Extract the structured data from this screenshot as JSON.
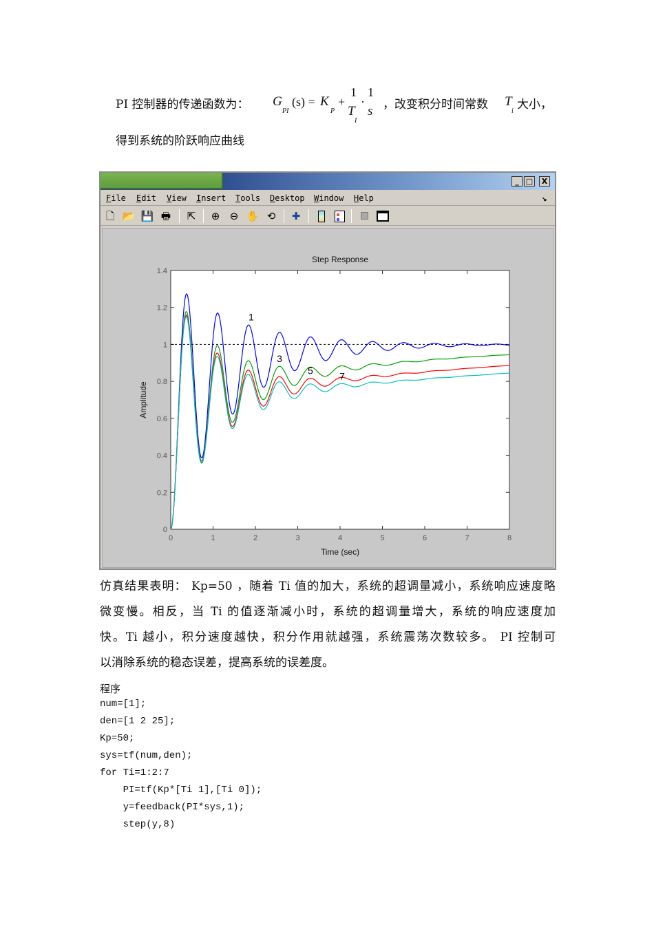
{
  "intro": {
    "prefix": "PI 控制器的传递函数为：",
    "formula": {
      "G": "G",
      "G_sub": "PI",
      "s_arg": "(s) =",
      "K": "K",
      "K_sub": "P",
      "plus": "+",
      "one1": "1",
      "T": "T",
      "T_sub": "I",
      "dot": "·",
      "one2": "1",
      "s": "s"
    },
    "mid": "，改变积分时间常数",
    "Ti": "T",
    "Ti_sub": "i",
    "suffix": "大小，",
    "line2": "得到系统的阶跃响应曲线"
  },
  "figure": {
    "window_buttons": {
      "minimize": "_",
      "maximize": "□",
      "close": "X"
    },
    "menu": [
      {
        "key": "F",
        "rest": "ile"
      },
      {
        "key": "E",
        "rest": "dit"
      },
      {
        "key": "V",
        "rest": "iew"
      },
      {
        "key": "I",
        "rest": "nsert"
      },
      {
        "key": "T",
        "rest": "ools"
      },
      {
        "key": "D",
        "rest": "esktop"
      },
      {
        "key": "W",
        "rest": "indow"
      },
      {
        "key": "H",
        "rest": "elp"
      }
    ],
    "dock_arrow": "↘",
    "toolbar_icons": [
      "new-file-icon",
      "open-folder-icon",
      "save-icon",
      "print-icon",
      "select-arrow-icon",
      "zoom-in-icon",
      "zoom-out-icon",
      "pan-hand-icon",
      "rotate-3d-icon",
      "data-cursor-icon",
      "colorbar-icon",
      "legend-icon",
      "hide-plot-tools-icon",
      "show-plot-tools-icon"
    ]
  },
  "chart_data": {
    "type": "line",
    "title": "Step Response",
    "xlabel": "Time (sec)",
    "ylabel": "Amplitude",
    "xlim": [
      0,
      8
    ],
    "ylim": [
      0,
      1.4
    ],
    "xticks": [
      "0",
      "1",
      "2",
      "3",
      "4",
      "5",
      "6",
      "7",
      "8"
    ],
    "yticks": [
      "0",
      "0.2",
      "0.4",
      "0.6",
      "0.8",
      "1",
      "1.2",
      "1.4"
    ],
    "reference_line": 1,
    "plant": {
      "num": [
        1
      ],
      "den": [
        1,
        2,
        25
      ]
    },
    "Kp": 50,
    "series": [
      {
        "name": "Ti=1",
        "label": "1",
        "Ti": 1,
        "color": "#0000ff",
        "peak": 1.27,
        "label_at": [
          1.9,
          1.13
        ]
      },
      {
        "name": "Ti=3",
        "label": "3",
        "Ti": 3,
        "color": "#00a000",
        "peak": 1.18,
        "label_at": [
          2.57,
          0.905
        ]
      },
      {
        "name": "Ti=5",
        "label": "5",
        "Ti": 5,
        "color": "#ff0000",
        "peak": 1.16,
        "label_at": [
          3.3,
          0.84
        ]
      },
      {
        "name": "Ti=7",
        "label": "7",
        "Ti": 7,
        "color": "#00c0c0",
        "peak": 1.15,
        "label_at": [
          4.05,
          0.81
        ]
      }
    ]
  },
  "conclusion": [
    "仿真结果表明： Kp=50 ，随着 Ti 值的加大，系统的超调量减小，系统响应速度略",
    "微变慢。相反，当 Ti 的值逐渐减小时，系统的超调量增大，系统的响应速度加",
    "快。Ti 越小，积分速度越快，积分作用就越强，系统震荡次数较多。 PI 控制可",
    "以消除系统的稳态误差，提高系统的误差度。"
  ],
  "program": {
    "heading": "程序",
    "lines": [
      "num=[1];",
      "den=[1 2 25];",
      "Kp=50;",
      "sys=tf(num,den);",
      "for Ti=1:2:7",
      "    PI=tf(Kp*[Ti 1],[Ti 0]);",
      "    y=feedback(PI*sys,1);",
      "    step(y,8)"
    ]
  }
}
